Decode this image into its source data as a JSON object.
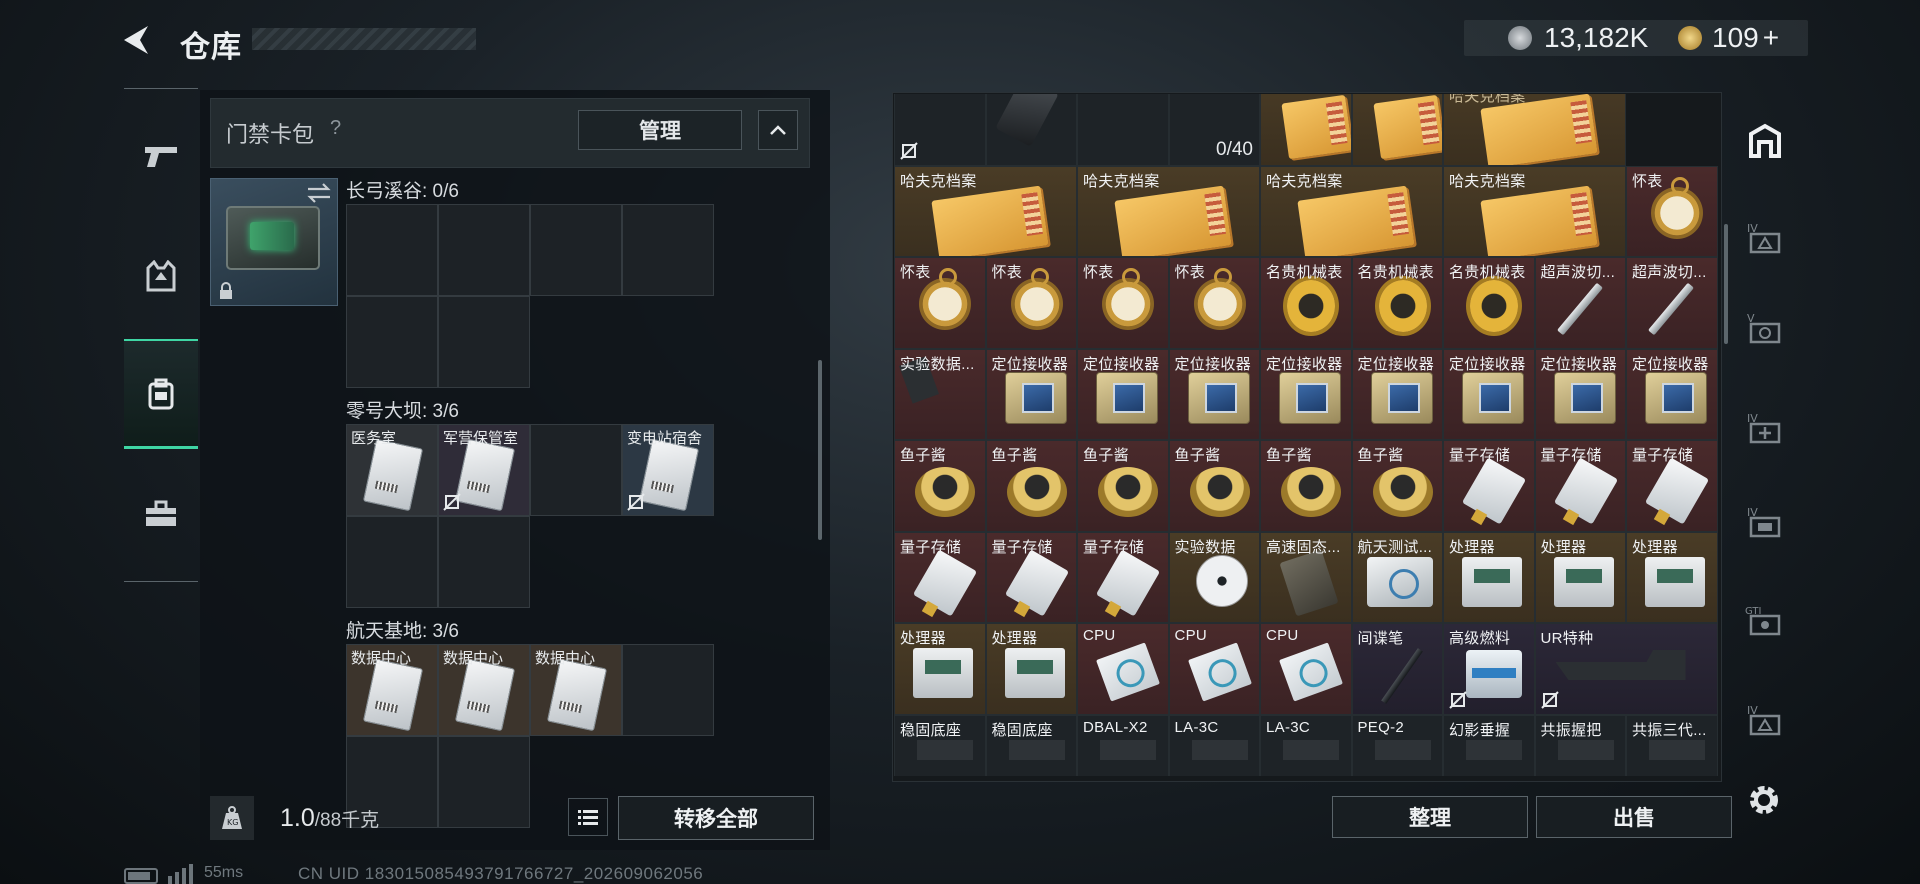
{
  "header": {
    "title": "仓库",
    "back_icon": "back-arrow-icon"
  },
  "currency": {
    "silver_amount": "13,182K",
    "gold_amount": "109",
    "gold_add": "+",
    "silver_icon": "silver-coin-icon",
    "gold_icon": "gold-coin-icon"
  },
  "left_nav": [
    {
      "name": "weapons",
      "icon": "pistol-icon"
    },
    {
      "name": "equipment",
      "icon": "vest-icon"
    },
    {
      "name": "backpack",
      "icon": "backpack-icon",
      "active": true
    },
    {
      "name": "toolbox",
      "icon": "toolbox-icon"
    }
  ],
  "keycard_case": {
    "title": "门禁卡包",
    "help": "?",
    "manage_label": "管理",
    "sections": [
      {
        "name": "长弓溪谷: 0/6",
        "slots": [
          "",
          "",
          "",
          "",
          "",
          ""
        ]
      },
      {
        "name": "零号大坝: 3/6",
        "slots": [
          "医务室",
          "军营保管室",
          "",
          "变电站宿舍",
          "",
          ""
        ]
      },
      {
        "name": "航天基地: 3/6",
        "slots": [
          "数据中心",
          "数据中心",
          "数据中心",
          "",
          "",
          ""
        ]
      }
    ]
  },
  "footer_left": {
    "weight_value": "1.0",
    "weight_unit": "/88千克",
    "transfer_label": "转移全部"
  },
  "stash": {
    "partial_count": "0/40",
    "rows": [
      [
        "哈夫克档案",
        "哈夫克档案",
        "哈夫克档案",
        "哈夫克档案",
        "怀表"
      ],
      [
        "怀表",
        "怀表",
        "怀表",
        "怀表",
        "名贵机械表",
        "名贵机械表",
        "名贵机械表",
        "超声波切...",
        "超声波切..."
      ],
      [
        "实验数据...",
        "定位接收器",
        "定位接收器",
        "定位接收器",
        "定位接收器",
        "定位接收器",
        "定位接收器",
        "定位接收器",
        "定位接收器"
      ],
      [
        "鱼子酱",
        "鱼子酱",
        "鱼子酱",
        "鱼子酱",
        "鱼子酱",
        "鱼子酱",
        "量子存储",
        "量子存储",
        "量子存储"
      ],
      [
        "量子存储",
        "量子存储",
        "量子存储",
        "实验数据",
        "高速固态...",
        "航天测试...",
        "处理器",
        "处理器",
        "处理器"
      ],
      [
        "处理器",
        "处理器",
        "CPU",
        "CPU",
        "CPU",
        "间谍笔",
        "高级燃料",
        "UR特种"
      ],
      [
        "稳固底座",
        "稳固底座",
        "DBAL-X2",
        "LA-3C",
        "LA-3C",
        "PEQ-2",
        "幻影垂握",
        "共振握把",
        "共振三代..."
      ]
    ],
    "top_partial_label": "哈夫克档案",
    "sort_label": "整理",
    "sell_label": "出售"
  },
  "right_nav": [
    {
      "name": "stash-main",
      "icon": "stash-icon"
    },
    {
      "name": "stash-tab-2",
      "icon": "tab-iv-icon"
    },
    {
      "name": "stash-tab-3",
      "icon": "tab-v-icon"
    },
    {
      "name": "stash-tab-4",
      "icon": "tab-iv-plus-icon"
    },
    {
      "name": "stash-tab-5",
      "icon": "tab-iv-case-icon"
    },
    {
      "name": "stash-tab-6",
      "icon": "tab-gti-icon"
    },
    {
      "name": "stash-tab-7",
      "icon": "tab-iv-icon"
    }
  ],
  "status": {
    "ping": "55ms",
    "uid": "CN UID 18301508549379176​6727_202609062056"
  }
}
